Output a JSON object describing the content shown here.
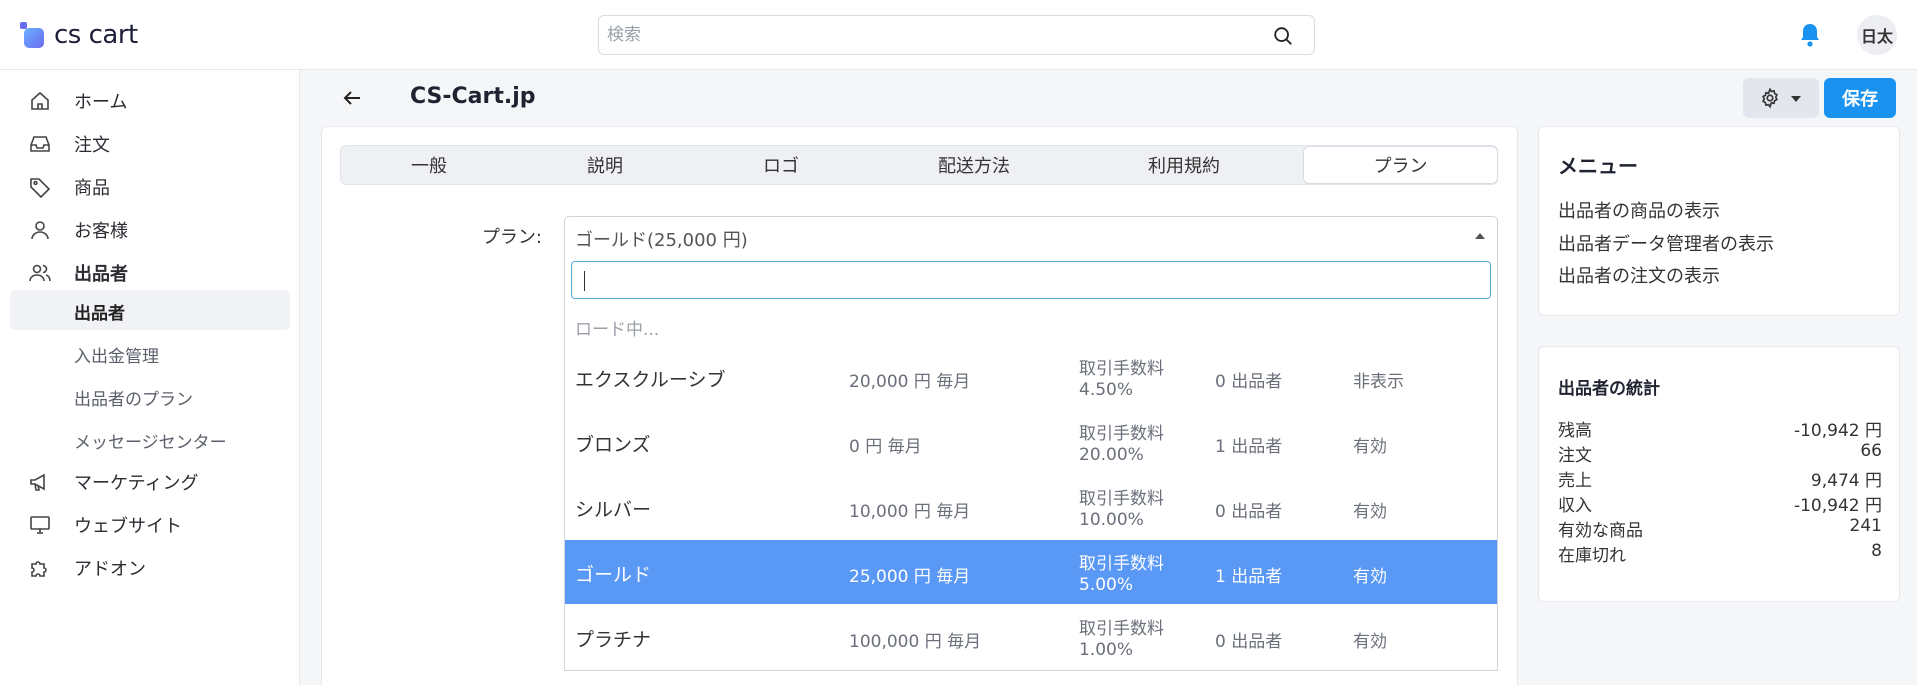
{
  "header": {
    "logo_text": "cs cart",
    "search_placeholder": "検索",
    "avatar_text": "日太"
  },
  "sidebar": {
    "items": [
      {
        "label": "ホーム",
        "icon": "home-icon"
      },
      {
        "label": "注文",
        "icon": "inbox-icon"
      },
      {
        "label": "商品",
        "icon": "tag-icon"
      },
      {
        "label": "お客様",
        "icon": "user-icon"
      },
      {
        "label": "出品者",
        "icon": "users-icon"
      },
      {
        "label": "マーケティング",
        "icon": "megaphone-icon"
      },
      {
        "label": "ウェブサイト",
        "icon": "monitor-icon"
      },
      {
        "label": "アドオン",
        "icon": "puzzle-icon"
      }
    ],
    "sub_items": [
      {
        "label": "出品者",
        "active": true
      },
      {
        "label": "入出金管理"
      },
      {
        "label": "出品者のプラン"
      },
      {
        "label": "メッセージセンター"
      }
    ]
  },
  "page": {
    "title": "CS-Cart.jp",
    "save_label": "保存"
  },
  "tabs": [
    "一般",
    "説明",
    "ロゴ",
    "配送方法",
    "利用規約",
    "プラン"
  ],
  "active_tab": "プラン",
  "plan_field": {
    "label": "プラン:",
    "selected_value": "ゴールド(25,000 円)",
    "loading_text": "ロード中...",
    "options": [
      {
        "name": "エクスクルーシブ",
        "price": "20,000 円 毎月",
        "fee_label": "取引手数料",
        "fee_value": "4.50%",
        "vendors": "0 出品者",
        "status": "非表示"
      },
      {
        "name": "ブロンズ",
        "price": "0 円 毎月",
        "fee_label": "取引手数料",
        "fee_value": "20.00%",
        "vendors": "1 出品者",
        "status": "有効"
      },
      {
        "name": "シルバー",
        "price": "10,000 円 毎月",
        "fee_label": "取引手数料",
        "fee_value": "10.00%",
        "vendors": "0 出品者",
        "status": "有効"
      },
      {
        "name": "ゴールド",
        "price": "25,000 円 毎月",
        "fee_label": "取引手数料",
        "fee_value": "5.00%",
        "vendors": "1 出品者",
        "status": "有効",
        "selected": true
      },
      {
        "name": "プラチナ",
        "price": "100,000 円 毎月",
        "fee_label": "取引手数料",
        "fee_value": "1.00%",
        "vendors": "0 出品者",
        "status": "有効"
      }
    ]
  },
  "menu": {
    "title": "メニュー",
    "links": [
      "出品者の商品の表示",
      "出品者データ管理者の表示",
      "出品者の注文の表示"
    ]
  },
  "stats": {
    "title": "出品者の統計",
    "rows": [
      {
        "key": "残高",
        "value": "-10,942 円"
      },
      {
        "key": "注文",
        "value": "66"
      },
      {
        "key": "売上",
        "value": "9,474 円"
      },
      {
        "key": "収入",
        "value": "-10,942 円"
      },
      {
        "key": "有効な商品",
        "value": "241"
      },
      {
        "key": "在庫切れ",
        "value": "8"
      }
    ]
  },
  "colors": {
    "accent": "#1a93f0",
    "selected_row": "#5a98f5",
    "bell": "#1a93f0"
  }
}
